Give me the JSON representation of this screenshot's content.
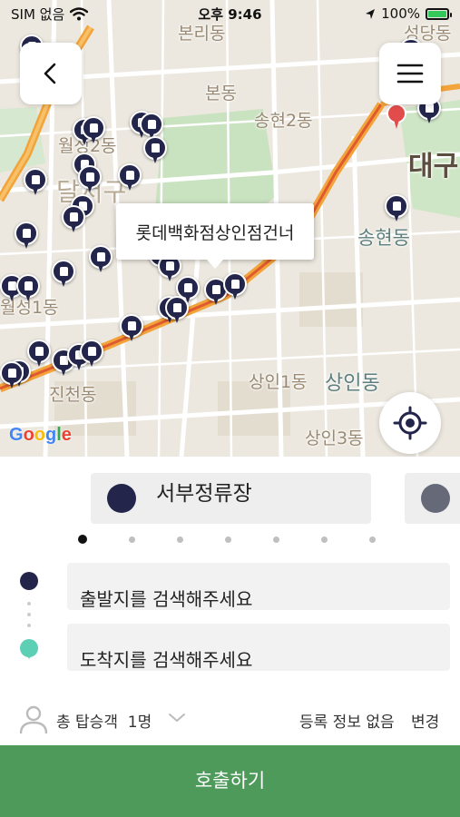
{
  "status_bar": {
    "carrier": "SIM 없음",
    "time": "오후 9:46",
    "battery": "100%"
  },
  "map": {
    "labels": [
      {
        "text": "본리동"
      },
      {
        "text": "성당동"
      },
      {
        "text": "본동"
      },
      {
        "text": "송현2동"
      },
      {
        "text": "월성2동"
      },
      {
        "text": "달서구"
      },
      {
        "text": "대구"
      },
      {
        "text": "송현동"
      },
      {
        "text": "월성1동"
      },
      {
        "text": "진천동"
      },
      {
        "text": "상인1동"
      },
      {
        "text": "상인동"
      },
      {
        "text": "상인3동"
      }
    ],
    "selected_stop_tooltip": "롯데백화점상인점건너",
    "attribution": "Google"
  },
  "stops": {
    "current": "서부정류장",
    "page_count": 7,
    "active_page": 1
  },
  "route": {
    "origin_placeholder": "출발지를 검색해주세요",
    "destination_placeholder": "도착지를 검색해주세요"
  },
  "passenger": {
    "label": "총 탑승객",
    "count": "1명",
    "registration": "등록 정보 없음",
    "change": "변경"
  },
  "call_button": "호출하기",
  "colors": {
    "navy": "#23264a",
    "teal": "#5ccfb4",
    "green": "#4e9a5b"
  }
}
